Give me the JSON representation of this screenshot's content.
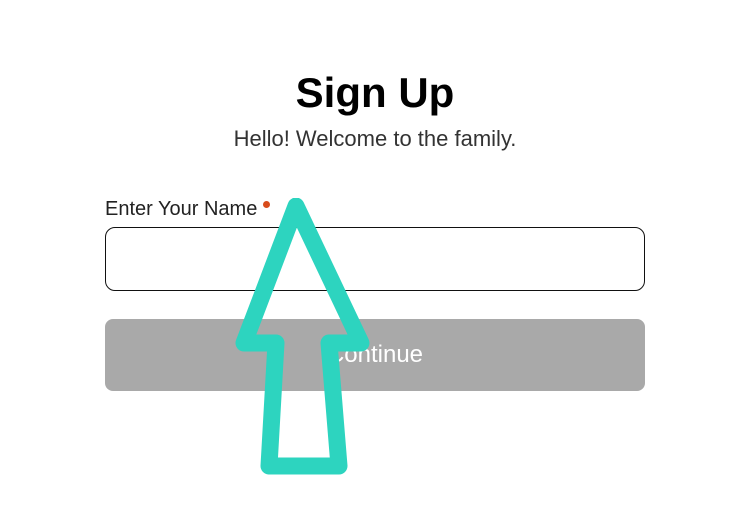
{
  "header": {
    "title": "Sign Up",
    "subtitle": "Hello! Welcome to the family."
  },
  "form": {
    "name_label": "Enter Your Name",
    "name_value": "",
    "continue_label": "Continue"
  },
  "colors": {
    "required": "#d84c1c",
    "button_bg": "#a9a9a9",
    "arrow": "#2dd4bf"
  }
}
